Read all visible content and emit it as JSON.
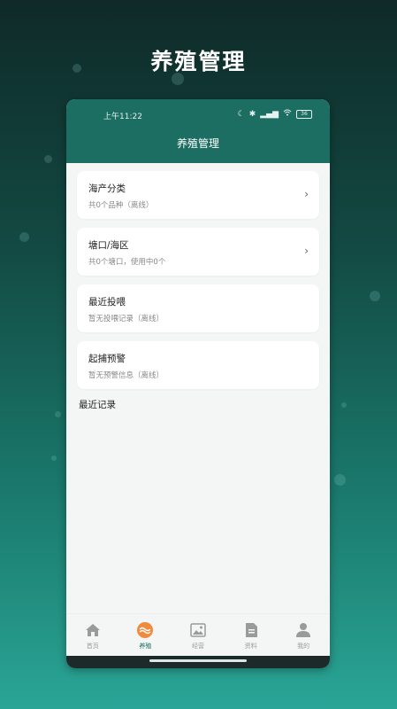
{
  "promo": {
    "title": "养殖管理"
  },
  "status": {
    "time": "上午11:22",
    "battery": "36"
  },
  "header": {
    "title": "养殖管理"
  },
  "cards": [
    {
      "title": "海产分类",
      "subtitle": "共0个品种（离线）",
      "chevron": true
    },
    {
      "title": "塘口/海区",
      "subtitle": "共0个塘口，使用中0个",
      "chevron": true
    },
    {
      "title": "最近投喂",
      "subtitle": "暂无投喂记录（离线）",
      "chevron": false
    },
    {
      "title": "起捕预警",
      "subtitle": "暂无预警信息（离线）",
      "chevron": false
    }
  ],
  "recent": {
    "title": "最近记录"
  },
  "tabs": [
    {
      "label": "首页",
      "icon": "home-icon",
      "active": false
    },
    {
      "label": "养殖",
      "icon": "fish-icon",
      "active": true
    },
    {
      "label": "经营",
      "icon": "image-icon",
      "active": false
    },
    {
      "label": "资料",
      "icon": "document-icon",
      "active": false
    },
    {
      "label": "我的",
      "icon": "profile-icon",
      "active": false
    }
  ],
  "colors": {
    "brand": "#1c6e62",
    "active_tab": "#f08a3c"
  }
}
